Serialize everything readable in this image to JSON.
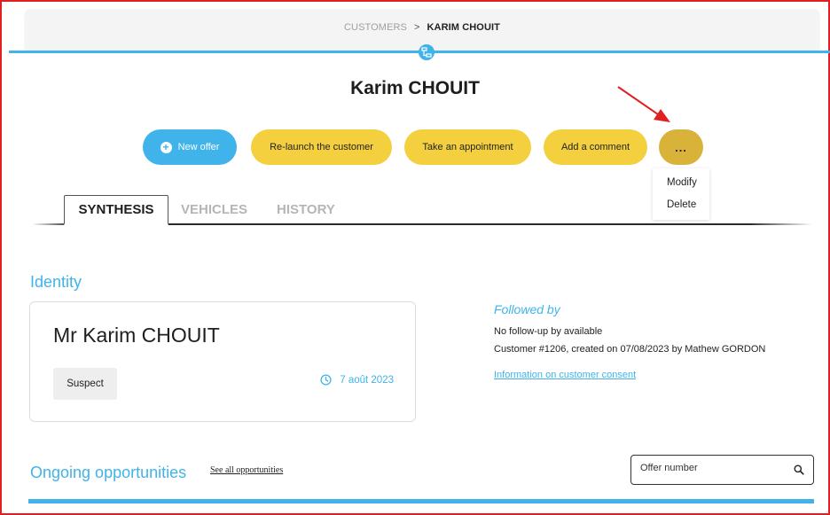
{
  "breadcrumb": {
    "parent": "CUSTOMERS",
    "separator": ">",
    "current": "KARIM CHOUIT"
  },
  "page_title": "Karim CHOUIT",
  "actions": {
    "new_offer": "New offer",
    "relaunch": "Re-launch the customer",
    "appointment": "Take an appointment",
    "comment": "Add a comment",
    "more": "..."
  },
  "more_menu": {
    "modify": "Modify",
    "delete": "Delete"
  },
  "tabs": [
    {
      "label": "SYNTHESIS",
      "active": true
    },
    {
      "label": "VEHICLES",
      "active": false
    },
    {
      "label": "HISTORY",
      "active": false
    }
  ],
  "identity": {
    "section_title": "Identity",
    "name": "Mr Karim CHOUIT",
    "status": "Suspect",
    "date": "7 août 2023"
  },
  "followed": {
    "title": "Followed by",
    "line1": "No follow-up by available",
    "line2": "Customer #1206, created on 07/08/2023 by Mathew GORDON",
    "consent_link": "Information on customer consent"
  },
  "opportunities": {
    "section_title": "Ongoing opportunities",
    "see_all": "See all opportunities",
    "search_placeholder": "Offer number"
  },
  "colors": {
    "accent": "#3fb3ea",
    "yellow": "#f4d03f",
    "more_button": "#d9b23a",
    "annotation_arrow": "#e02020"
  },
  "icons": [
    "org-chart-icon",
    "plus-circle-icon",
    "clock-icon",
    "search-icon",
    "annotation-arrow"
  ]
}
